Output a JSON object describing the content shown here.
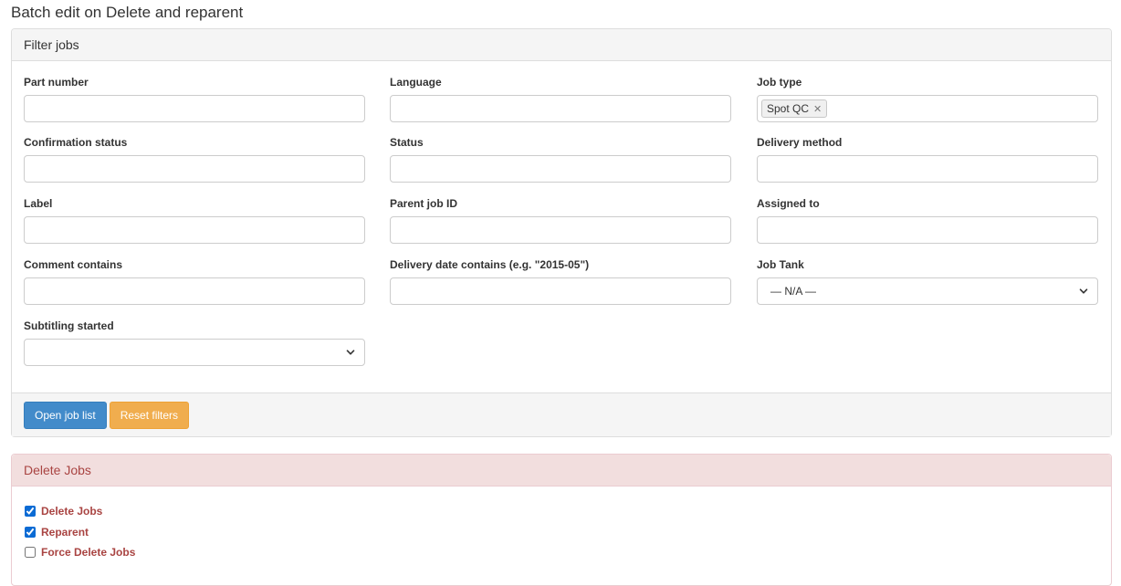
{
  "page": {
    "title": "Batch edit on Delete and reparent"
  },
  "filter_panel": {
    "heading": "Filter jobs",
    "fields": {
      "part_number": {
        "label": "Part number",
        "value": ""
      },
      "language": {
        "label": "Language",
        "value": ""
      },
      "job_type": {
        "label": "Job type",
        "tags": [
          "Spot QC"
        ],
        "remove_glyph": "✕"
      },
      "confirmation_status": {
        "label": "Confirmation status",
        "value": ""
      },
      "status": {
        "label": "Status",
        "value": ""
      },
      "delivery_method": {
        "label": "Delivery method",
        "value": ""
      },
      "label": {
        "label": "Label",
        "value": ""
      },
      "parent_job_id": {
        "label": "Parent job ID",
        "value": ""
      },
      "assigned_to": {
        "label": "Assigned to",
        "value": ""
      },
      "comment_contains": {
        "label": "Comment contains",
        "value": ""
      },
      "delivery_date_contains": {
        "label": "Delivery date contains (e.g. \"2015-05\")",
        "value": ""
      },
      "job_tank": {
        "label": "Job Tank",
        "selected": "— N/A —"
      },
      "subtitling_started": {
        "label": "Subtitling started",
        "selected": ""
      }
    },
    "buttons": {
      "open_job_list": "Open job list",
      "reset_filters": "Reset filters"
    }
  },
  "delete_panel": {
    "heading": "Delete Jobs",
    "options": [
      {
        "label": "Delete Jobs",
        "checked": true
      },
      {
        "label": "Reparent",
        "checked": true
      },
      {
        "label": "Force Delete Jobs",
        "checked": false
      }
    ]
  },
  "icons": {
    "select_arrow": "chevron-down-icon",
    "tag_remove": "close-icon"
  },
  "colors": {
    "primary": "#428bca",
    "warning": "#f0ad4e",
    "danger_text": "#a94442",
    "danger_bg": "#f2dede"
  }
}
